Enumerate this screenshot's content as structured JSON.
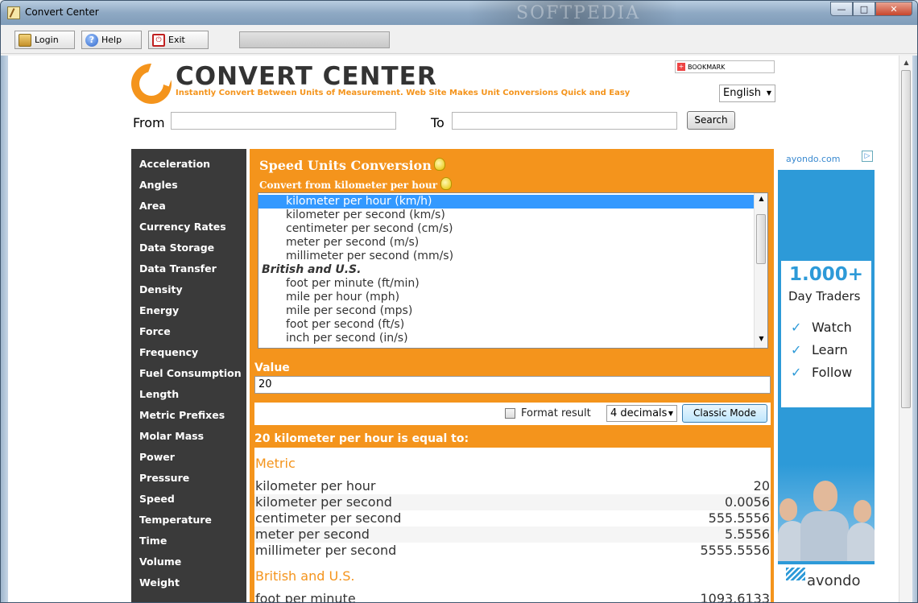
{
  "window": {
    "title": "Convert Center",
    "watermark": "SOFTPEDIA"
  },
  "toolbar": {
    "login": "Login",
    "help": "Help",
    "exit": "Exit"
  },
  "header": {
    "brand": "CONVERT CENTER",
    "tagline": "Instantly Convert Between Units of Measurement. Web Site Makes Unit Conversions Quick and Easy",
    "bookmark": "BOOKMARK",
    "language": "English"
  },
  "search": {
    "from_label": "From",
    "to_label": "To",
    "button": "Search",
    "from_value": "",
    "to_value": ""
  },
  "sidebar": {
    "items": [
      "Acceleration",
      "Angles",
      "Area",
      "Currency Rates",
      "Data Storage",
      "Data Transfer",
      "Density",
      "Energy",
      "Force",
      "Frequency",
      "Fuel Consumption",
      "Length",
      "Metric Prefixes",
      "Molar Mass",
      "Power",
      "Pressure",
      "Speed",
      "Temperature",
      "Time",
      "Volume",
      "Weight"
    ]
  },
  "main": {
    "title": "Speed Units Conversion",
    "convert_from": "Convert from kilometer per hour",
    "options": [
      "kilometer per hour (km/h)",
      "kilometer per second (km/s)",
      "centimeter per second (cm/s)",
      "meter per second (m/s)",
      "millimeter per second (mm/s)"
    ],
    "group": "British and U.S.",
    "options2": [
      "foot per minute (ft/min)",
      "mile per hour (mph)",
      "mile per second (mps)",
      "foot per second (ft/s)",
      "inch per second (in/s)"
    ],
    "value_label": "Value",
    "value": "20",
    "format_label": "Format result",
    "decimals": "4 decimals",
    "classic_mode": "Classic Mode",
    "result_header": "20 kilometer per hour is equal to:",
    "sections": {
      "metric": "Metric",
      "british": "British and U.S."
    },
    "results": [
      {
        "name": "kilometer per hour",
        "value": "20"
      },
      {
        "name": "kilometer per second",
        "value": "0.0056"
      },
      {
        "name": "centimeter per second",
        "value": "555.5556"
      },
      {
        "name": "meter per second",
        "value": "5.5556"
      },
      {
        "name": "millimeter per second",
        "value": "5555.5556"
      }
    ],
    "partial_row": {
      "name": "foot per minute",
      "value": "1093.6133"
    }
  },
  "ad": {
    "domain": "ayondo.com",
    "count": "1.000+",
    "subtitle": "Day Traders",
    "checks": [
      "Watch",
      "Learn",
      "Follow"
    ],
    "brand": "avondo"
  }
}
